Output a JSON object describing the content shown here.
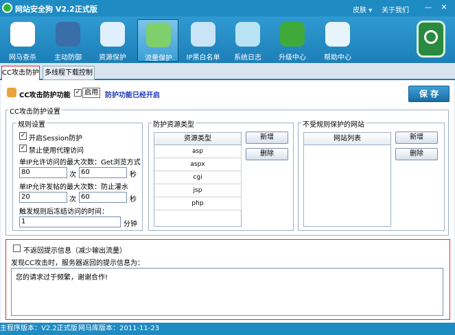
{
  "window": {
    "title": "网站安全狗 V2.2正式版",
    "menu_skin": "皮肤",
    "menu_about": "关于我们",
    "minimize": "—",
    "close": "✕"
  },
  "toolbar": [
    {
      "label": "网马查杀",
      "icon": "trojan-scan-icon",
      "color": "#ffffff"
    },
    {
      "label": "主动防御",
      "icon": "monitor-defense-icon",
      "color": "#3a6ea8"
    },
    {
      "label": "资源保护",
      "icon": "resource-shield-icon",
      "color": "#e0f0ff"
    },
    {
      "label": "流量保护",
      "icon": "traffic-shield-icon",
      "color": "#7ed06c"
    },
    {
      "label": "IP黑白名单",
      "icon": "ip-list-icon",
      "color": "#c8e4f6"
    },
    {
      "label": "系统日志",
      "icon": "system-log-icon",
      "color": "#b7e3f4"
    },
    {
      "label": "升级中心",
      "icon": "upgrade-icon",
      "color": "#3faa3a"
    },
    {
      "label": "帮助中心",
      "icon": "help-icon",
      "color": "#e8f4fc"
    }
  ],
  "tabs": [
    "CC攻击防护",
    "多线程下载控制"
  ],
  "cc": {
    "feature_label": "CC攻击防护功能",
    "enable_label": "启用",
    "enable_checked": "✓",
    "status_text": "防护功能已经开启",
    "save_label": "保 存",
    "settings_group": "CC攻击防护设置",
    "rules": {
      "group": "规则设置",
      "session_label": "开启Session防护",
      "session_checked": "✓",
      "proxy_label": "禁止使用代理访问",
      "proxy_checked": "✓",
      "max_access_label": "单IP允许访问的最大次数：Get浏览方式",
      "max_access_count": "80",
      "count_unit": "次",
      "max_access_seconds": "60",
      "seconds_unit": "秒",
      "max_post_label": "单IP允许发帖的最大次数：防止灌水",
      "max_post_count": "20",
      "max_post_seconds": "60",
      "freeze_label": "触发规则后冻结访问的时间：",
      "freeze_value": "1",
      "minute_unit": "分钟"
    },
    "resources": {
      "group": "防护资源类型",
      "header": "资源类型",
      "items": [
        "asp",
        "aspx",
        "cgi",
        "jsp",
        "php"
      ],
      "add_label": "新增",
      "delete_label": "删除"
    },
    "whitelist": {
      "group": "不受规则保护的网站",
      "header": "网站列表",
      "add_label": "新增",
      "delete_label": "删除"
    },
    "message": {
      "no_return_label": "不返回提示信息（减少输出流量）",
      "prompt_label": "发现CC攻击时，服务器返回的提示信息为：",
      "text": "您的请求过于频繁，谢谢合作!"
    }
  },
  "status": {
    "program_version": "主程序版本：V2.2正式版",
    "db_version": "网马库版本：2011-11-23"
  }
}
